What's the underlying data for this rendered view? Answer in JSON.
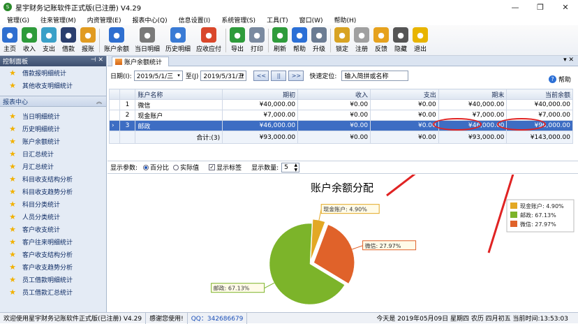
{
  "window": {
    "title": "星宇财务记账软件正式版(已注册) V4.29"
  },
  "menu": [
    "管理(G)",
    "往来管理(M)",
    "内资管理(E)",
    "报表中心(Q)",
    "信息设置(I)",
    "系统管理(S)",
    "工具(T)",
    "窗口(W)",
    "帮助(H)"
  ],
  "toolbar": [
    {
      "label": "主页",
      "icon": "home-icon",
      "color": "#2f6fd0"
    },
    {
      "label": "收入",
      "icon": "income-icon",
      "color": "#2e9b3b"
    },
    {
      "label": "支出",
      "icon": "expense-icon",
      "color": "#3aa0c8"
    },
    {
      "label": "借款",
      "icon": "borrow-icon",
      "color": "#2b3f6e"
    },
    {
      "label": "报账",
      "icon": "reimburse-icon",
      "color": "#e19b21"
    },
    {
      "label": "账户余额",
      "icon": "balance-icon",
      "color": "#2f6fd0"
    },
    {
      "label": "当日明细",
      "icon": "daily-detail-icon",
      "color": "#7a7a7a"
    },
    {
      "label": "历史明细",
      "icon": "history-icon",
      "color": "#3a7bd5"
    },
    {
      "label": "应收应付",
      "icon": "receivable-icon",
      "color": "#d9472b"
    },
    {
      "label": "导出",
      "icon": "export-icon",
      "color": "#2e9b3b"
    },
    {
      "label": "打印",
      "icon": "print-icon",
      "color": "#7a8aa0"
    },
    {
      "label": "刷新",
      "icon": "refresh-icon",
      "color": "#2e9b3b"
    },
    {
      "label": "帮助",
      "icon": "help-icon",
      "color": "#2b6fd6"
    },
    {
      "label": "升级",
      "icon": "upgrade-icon",
      "color": "#6b7c93"
    },
    {
      "label": "锁定",
      "icon": "lock-icon",
      "color": "#d8a323"
    },
    {
      "label": "注册",
      "icon": "register-icon",
      "color": "#a0a0a0"
    },
    {
      "label": "反馈",
      "icon": "feedback-icon",
      "color": "#e6a21e"
    },
    {
      "label": "隐藏",
      "icon": "hide-icon",
      "color": "#555555"
    },
    {
      "label": "退出",
      "icon": "exit-icon",
      "color": "#e8b400"
    }
  ],
  "left_panel": {
    "title": "控制面板",
    "top_items": [
      "借款报明细统计",
      "其他收支明细统计"
    ],
    "group_title": "报表中心",
    "report_items": [
      "当日明细统计",
      "历史明细统计",
      "账户余额统计",
      "日汇总统计",
      "月汇总统计",
      "科目收支结构分析",
      "科目收支趋势分析",
      "科目分类统计",
      "人员分类统计",
      "客户收支统计",
      "客户往来明细统计",
      "客户收支结构分析",
      "客户收支趋势分析",
      "员工借款明细统计",
      "员工借款汇总统计"
    ]
  },
  "tab": {
    "label": "账户余额统计"
  },
  "filter": {
    "date_label": "日期(I):",
    "date_from": "2019/5/1/三",
    "to_label": "至(J)",
    "date_to": "2019/5/31/五",
    "quick_label": "快速定位:",
    "search_placeholder": "输入简拼或名称",
    "help_label": "帮助"
  },
  "table": {
    "columns": [
      "账户名称",
      "期初",
      "收入",
      "支出",
      "期末",
      "当前余额"
    ],
    "rows": [
      {
        "no": "1",
        "name": "微信",
        "begin": "¥40,000.00",
        "income": "¥0.00",
        "expense": "¥0.00",
        "end": "¥40,000.00",
        "balance": "¥40,000.00"
      },
      {
        "no": "2",
        "name": "现金账户",
        "begin": "¥7,000.00",
        "income": "¥0.00",
        "expense": "¥0.00",
        "end": "¥7,000.00",
        "balance": "¥7,000.00"
      },
      {
        "no": "3",
        "name": "邮政",
        "begin": "¥46,000.00",
        "income": "¥0.00",
        "expense": "¥0.00",
        "end": "¥46,000.00",
        "balance": "¥96,000.00"
      }
    ],
    "summary": {
      "label": "合计:(3)",
      "begin": "¥93,000.00",
      "income": "¥0.00",
      "expense": "¥0.00",
      "end": "¥93,000.00",
      "balance": "¥143,000.00"
    }
  },
  "options": {
    "label": "显示参数:",
    "percent": "百分比",
    "actual": "实际值",
    "show_label": "显示标签",
    "count_label": "显示数量:",
    "count": "5"
  },
  "chart_data": {
    "type": "pie",
    "title": "账户余额分配",
    "slices": [
      {
        "name": "现金账户",
        "percent": 4.9,
        "color": "#e3a824",
        "label": "现金账户: 4.90%"
      },
      {
        "name": "邮政",
        "percent": 67.13,
        "color": "#7cb42a",
        "label": "邮政: 67.13%"
      },
      {
        "name": "微信",
        "percent": 27.97,
        "color": "#e0622a",
        "label": "微信: 27.97%"
      }
    ],
    "legend_position": "top-right",
    "colors": {
      "arrow": "#e02323"
    }
  },
  "status": {
    "welcome": "欢迎使用星宇财务记账软件正式版(已注册) V4.29",
    "thanks": "感谢您使用!",
    "qq": "QQ：342686679",
    "date": "今天是 2019年05月09日 星期四 农历 四月初五 当前时间:13:53:03"
  }
}
